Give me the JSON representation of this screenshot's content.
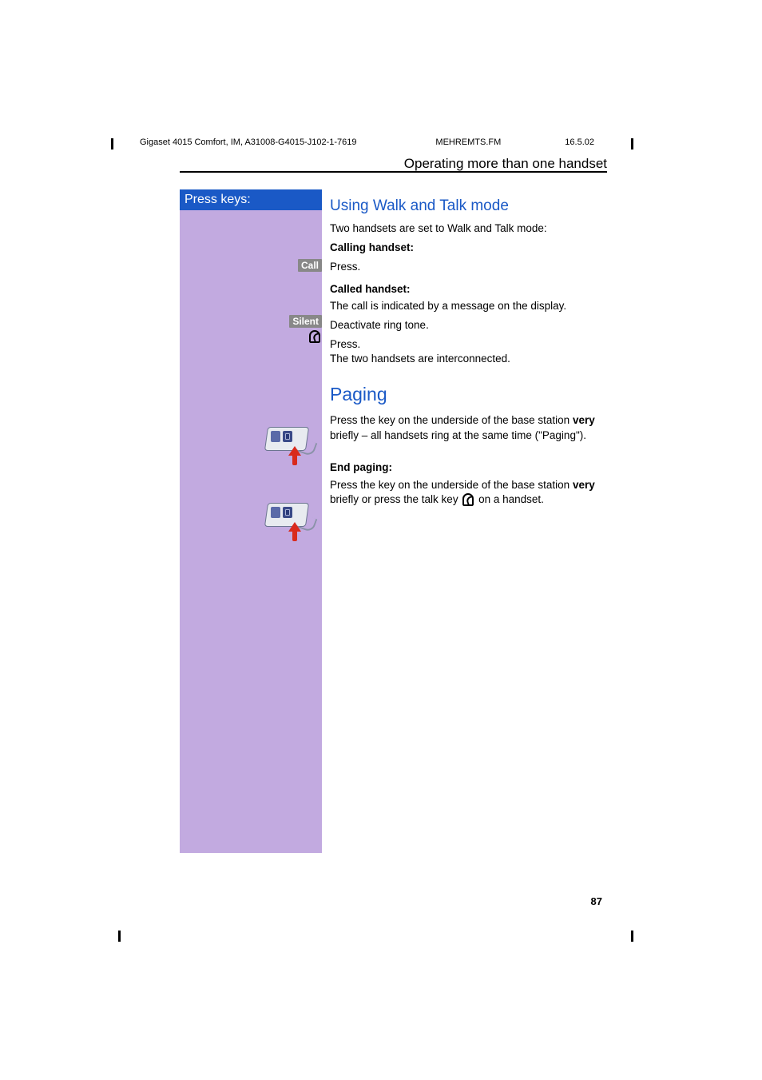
{
  "meta": {
    "header_left": "Gigaset 4015 Comfort, IM, A31008-G4015-J102-1-7619",
    "header_mid": "MEHREMTS.FM",
    "header_date": "16.5.02",
    "section_title": "Operating more than one handset",
    "page_number": "87"
  },
  "sidebar": {
    "title": "Press keys:"
  },
  "keys": {
    "call": "Call",
    "silent": "Silent"
  },
  "body": {
    "h2_walk_talk": "Using Walk and Talk mode",
    "wt_intro": "Two handsets are set to Walk and Talk mode:",
    "calling_label": "Calling handset:",
    "press": "Press.",
    "called_label": "Called handset:",
    "called_text": "The call is indicated by a message on the display.",
    "deactivate": "Deactivate ring tone.",
    "interconnected": "The two handsets are interconnected.",
    "h1_paging": "Paging",
    "paging_1a": "Press the key on the underside of the base station ",
    "very": "very",
    "paging_1b": " briefly  –  all handsets ring at the same time (\"Paging\").",
    "end_paging_label": "End paging:",
    "paging_2a": "Press the key on the underside of the base station ",
    "paging_2b": " briefly or press the talk key ",
    "paging_2c": " on a handset."
  }
}
